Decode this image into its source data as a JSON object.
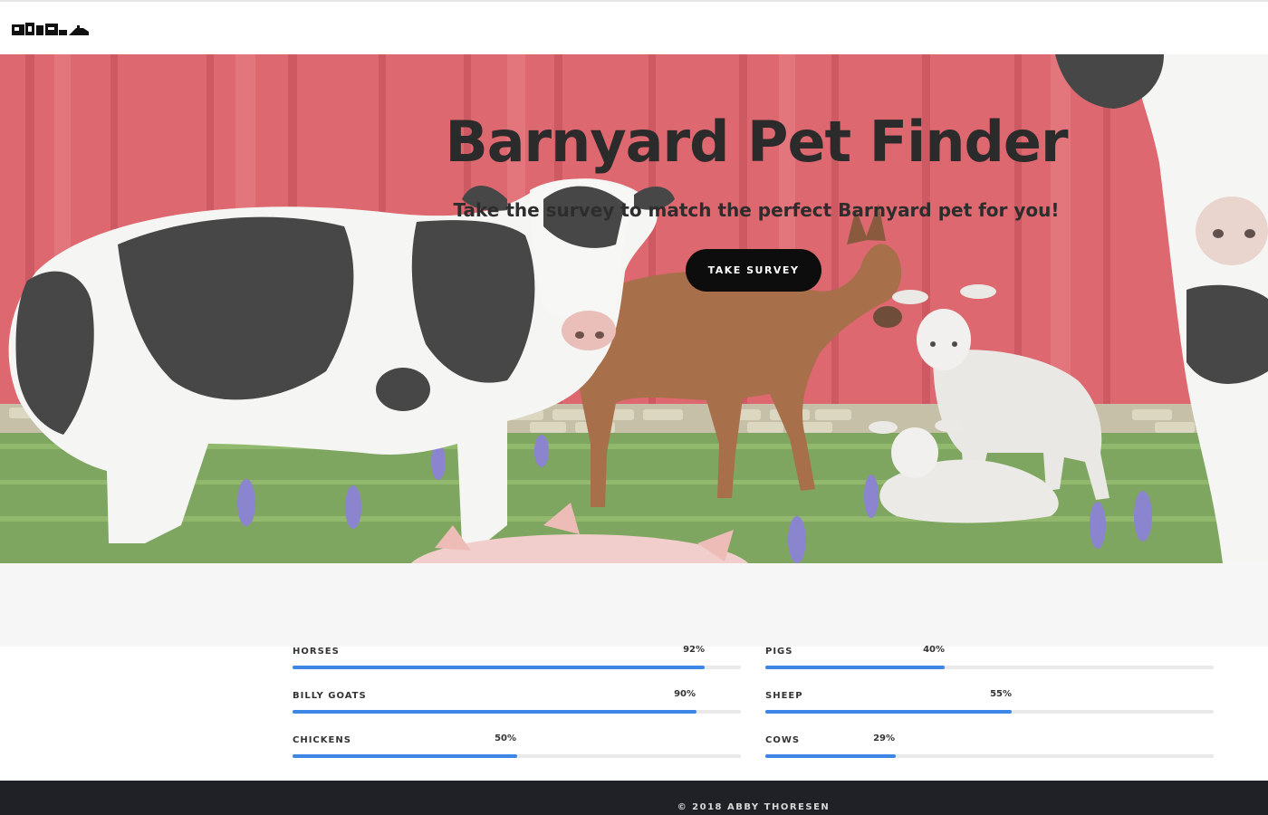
{
  "hero": {
    "title": "Barnyard Pet Finder",
    "subtitle": "Take the survey to match the perfect Barnyard pet for you!",
    "button_label": "TAKE SURVEY"
  },
  "skills": [
    {
      "label": "HORSES",
      "percent_label": "92%",
      "value": 92
    },
    {
      "label": "PIGS",
      "percent_label": "40%",
      "value": 40
    },
    {
      "label": "BILLY GOATS",
      "percent_label": "90%",
      "value": 90
    },
    {
      "label": "SHEEP",
      "percent_label": "55%",
      "value": 55
    },
    {
      "label": "CHICKENS",
      "percent_label": "50%",
      "value": 50
    },
    {
      "label": "COWS",
      "percent_label": "29%",
      "value": 29
    }
  ],
  "footer": {
    "copyright": "© 2018 ABBY THORESEN"
  },
  "colors": {
    "barn_red": "#d9545c",
    "progress_fill": "#3d86e6",
    "footer_bg": "#1f2126",
    "button_bg": "#0d0d0d"
  },
  "icons": {
    "logo": "cow-and-barn-logo-icon"
  }
}
